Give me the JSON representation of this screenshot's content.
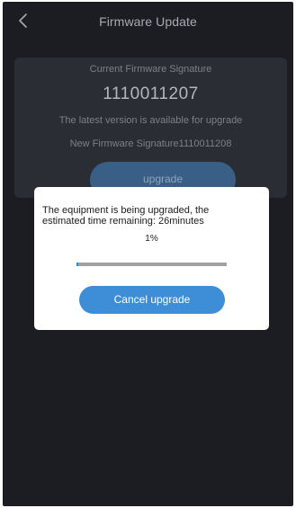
{
  "header": {
    "title": "Firmware Update",
    "back_icon": "chevron-left-icon"
  },
  "firmware": {
    "current_label": "Current Firmware Signature",
    "current_value": "1110011207",
    "latest_text": "The latest version is available for upgrade",
    "new_signature_text": "New Firmware Signature1110011208",
    "upgrade_label": "upgrade"
  },
  "dialog": {
    "message_line1": "The equipment is being upgraded, the",
    "message_line2": "estimated time remaining: 26minutes",
    "percent_text": "1%",
    "progress_fraction": 0.01,
    "cancel_label": "Cancel upgrade"
  },
  "colors": {
    "background": "#1c1c23",
    "card": "#2b2d35",
    "accent": "#3d8ed7",
    "dialog": "#ffffff"
  }
}
